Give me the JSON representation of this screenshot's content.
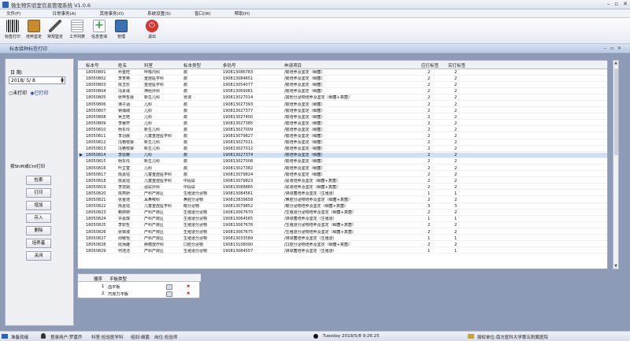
{
  "window": {
    "title": "微生物实验室信息管理系统 V1.0.6"
  },
  "menu": [
    "文件(F)",
    "日常事务(A)",
    "其他事务(O)",
    "系统设置(S)",
    "窗口(W)",
    "帮助(H)"
  ],
  "toolbar": [
    {
      "label": "标签打印",
      "icon": "barcode-icon",
      "color": "#2e3440"
    },
    {
      "label": "培养鉴定",
      "icon": "culture-icon",
      "color": "#c98a2b"
    },
    {
      "label": "常规鉴定",
      "icon": "pen-icon",
      "color": "#6b7280"
    },
    {
      "label": "工作列表",
      "icon": "list-icon",
      "color": "#9aa3b2"
    },
    {
      "label": "信息查询",
      "icon": "plus-icon",
      "color": "#2f9e44"
    },
    {
      "label": "管理",
      "icon": "monitor-icon",
      "color": "#3b6fb6"
    },
    {
      "label": "退出",
      "icon": "power-icon",
      "color": "#d93030"
    }
  ],
  "subwindow": {
    "title": "标本接种标签打印"
  },
  "left": {
    "date_label": "日  期:",
    "date_value": "2018/ 5/ 8",
    "radio_unprinted": "○未打印",
    "radio_printed": "◉已打印",
    "hint": "按Shift或Ctrl打印",
    "buttons": [
      "检索",
      "打印",
      "增加",
      "存入",
      "删除",
      "培养基",
      "关闭"
    ]
  },
  "table": {
    "headers": [
      "标本号",
      "姓名",
      "科室",
      "标本类型",
      "条码号",
      "申请项目",
      "应打标签",
      "实打标签"
    ],
    "rows": [
      [
        "18050801",
        "乔金旺",
        "呼吸内科",
        "痰",
        "190813086783",
        "/痰培养及鉴定（细菌）",
        "2",
        "2"
      ],
      [
        "18050802",
        "李育英",
        "重症医学科",
        "痰",
        "190813084651",
        "/痰培养及鉴定（细菌）",
        "2",
        "2"
      ],
      [
        "18050803",
        "陈玉珍",
        "重症医学科",
        "痰",
        "190813054077",
        "/痰培养及鉴定（细菌）",
        "2",
        "2"
      ],
      [
        "18050804",
        "冯素珠",
        "神经外科",
        "痰",
        "190813069081",
        "/痰培养及鉴定（细菌）",
        "2",
        "2"
      ],
      [
        "18050805",
        "张梓哲晨",
        "新生儿科",
        "胃液",
        "190813027014",
        "/其他分泌物培养及鉴定（细菌+真菌）",
        "2",
        "2"
      ],
      [
        "18050806",
        "谭子涵",
        "儿科",
        "痰",
        "190813027393",
        "/痰培养及鉴定（细菌）",
        "2",
        "2"
      ],
      [
        "18050807",
        "钟海城",
        "儿科",
        "痰",
        "190813027377",
        "/痰培养及鉴定（细菌）",
        "2",
        "2"
      ],
      [
        "18050808",
        "吴正皓",
        "儿科",
        "痰",
        "190813027400",
        "/痰培养及鉴定（细菌）",
        "2",
        "2"
      ],
      [
        "18050809",
        "李睿轩",
        "儿科",
        "痰",
        "190813027385",
        "/痰培养及鉴定（细菌）",
        "2",
        "2"
      ],
      [
        "18050810",
        "杨东伶",
        "新生儿科",
        "痰",
        "190813027009",
        "/痰培养及鉴定（细菌）",
        "2",
        "2"
      ],
      [
        "18050811",
        "李羽晨",
        "儿童重症医学科",
        "痰",
        "190813079827",
        "/痰培养及鉴定（细菌）",
        "2",
        "2"
      ],
      [
        "18050812",
        "冯艳枝婴",
        "新生儿科",
        "痰",
        "190813027011",
        "/痰培养及鉴定（细菌）",
        "2",
        "2"
      ],
      [
        "18050813",
        "冯艳枝婴",
        "新生儿科",
        "痰",
        "190813027012",
        "/痰培养及鉴定（细菌）",
        "2",
        "2"
      ],
      [
        "18050814",
        "李思薇",
        "儿科",
        "痰",
        "190813027374",
        "/痰培养及鉴定（细菌）",
        "2",
        "2"
      ],
      [
        "18050815",
        "杨东伶",
        "新生儿科",
        "痰",
        "190813027008",
        "/痰培养及鉴定（细菌）",
        "2",
        "2"
      ],
      [
        "18050816",
        "叶芷萱",
        "儿科",
        "痰",
        "190813027382",
        "/痰培养及鉴定（细菌）",
        "2",
        "2"
      ],
      [
        "18050817",
        "陈嘉钰",
        "儿童重症医学科",
        "痰",
        "190813079824",
        "/痰培养及鉴定（细菌）",
        "2",
        "2"
      ],
      [
        "18050818",
        "陈嘉钰",
        "儿童重症医学科",
        "中段尿",
        "190813079823",
        "/尿液培养及鉴定（细菌+真菌）",
        "2",
        "2"
      ],
      [
        "18050819",
        "李慧娟",
        "泌尿外科",
        "中段尿",
        "190813088865",
        "/尿液培养及鉴定（细菌+真菌）",
        "2",
        "2"
      ],
      [
        "18050820",
        "陈燕娇",
        "产科产房区",
        "生殖道分泌物",
        "190813084561",
        "/淋球菌培养及鉴定（生殖道）",
        "1",
        "1"
      ],
      [
        "18050821",
        "张金培",
        "耳鼻喉科",
        "鼻腔分泌物",
        "190813839658",
        "/鼻腔分泌物培养及鉴定（细菌+真菌）",
        "2",
        "2"
      ],
      [
        "18050822",
        "陈嘉钰",
        "儿童重症医学科",
        "眼分泌物",
        "190813079852",
        "/眼分泌物培养及鉴定（细菌+真菌）",
        "3",
        "3"
      ],
      [
        "18050823",
        "赖婷婷",
        "产科产房区",
        "生殖道分泌物",
        "190813067670",
        "/生殖道分泌物培养及鉴定（细菌+真菌）",
        "2",
        "2"
      ],
      [
        "18050824",
        "许嘉琪",
        "产科产房区",
        "生殖道分泌物",
        "190813064565",
        "/淋球菌培养及鉴定（生殖道）",
        "1",
        "1"
      ],
      [
        "18050825",
        "李钦哲",
        "产科产房区",
        "生殖道分泌物",
        "190813067676",
        "/生殖道分泌物培养及鉴定（细菌+真菌）",
        "2",
        "2"
      ],
      [
        "18050826",
        "张锦淑",
        "产科产房区",
        "生殖道分泌物",
        "190813067675",
        "/生殖道分泌物培养及鉴定（细菌+真菌）",
        "2",
        "2"
      ],
      [
        "18050827",
        "周敏怡",
        "产科产房区",
        "生殖道分泌物",
        "190813033589",
        "/淋球菌培养及鉴定（生殖道）",
        "1",
        "1"
      ],
      [
        "18050828",
        "阮炳雄",
        "肿瘤放疗科",
        "口腔分泌物",
        "190813108090",
        "/口腔分泌物培养及鉴定（细菌+真菌）",
        "2",
        "2"
      ],
      [
        "18050829",
        "何浩洁",
        "产科产房区",
        "生殖道分泌物",
        "190813084557",
        "/淋球菌培养及鉴定（生殖道）",
        "1",
        "1"
      ]
    ]
  },
  "subtable": {
    "headers": [
      "顺序",
      "平板类型"
    ],
    "rows": [
      [
        "1",
        "血平板"
      ],
      [
        "2",
        "巧克力平板"
      ]
    ]
  },
  "status": {
    "app": "准备就绪",
    "user": "登录用户:罗嘉乔",
    "dept": "科室:检验医学科",
    "group": "组别:细菌",
    "post": "岗位:检验师",
    "datetime": "Tuesday 2018/5/8 9:26:25",
    "org": "授权单位:南方医科大学第五附属医院"
  }
}
